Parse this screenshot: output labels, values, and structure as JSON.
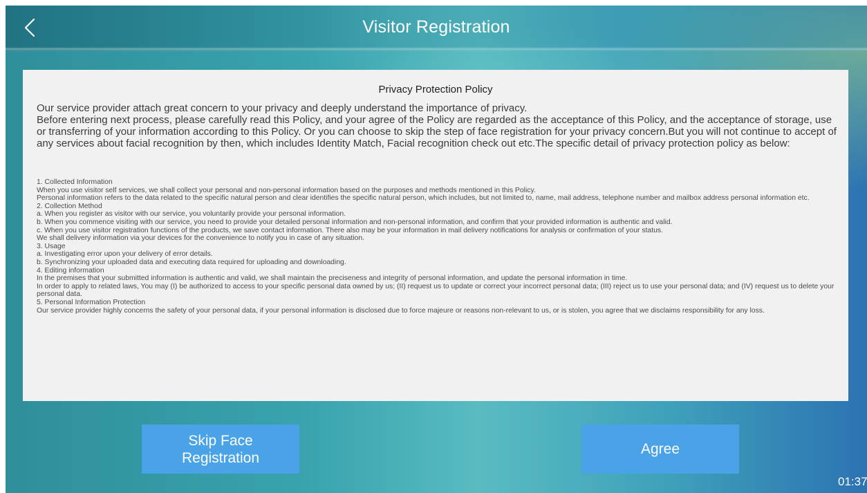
{
  "header": {
    "title": "Visitor Registration",
    "back_icon": "chevron-left-icon"
  },
  "policy": {
    "title": "Privacy Protection Policy",
    "intro": [
      "Our service provider attach great concern to your privacy and deeply understand the importance of privacy.",
      "Before entering next process, please carefully read this Policy, and your agree of the Policy are regarded as the acceptance of this Policy, and the acceptance of storage, use or transferring of your information according to this Policy. Or you can choose to skip the step of face registration for your privacy concern.But you will not continue to accept of any services about facial recognition by then, which includes Identity Match, Facial recognition check out etc.The specific detail of privacy protection policy as below:"
    ],
    "body": [
      "1. Collected Information",
      "When you use visitor self services, we shall collect your personal and non-personal information based on the purposes and methods mentioned in this Policy.",
      "Personal information refers to the data related to the specific natural person and clear identifies the specific natural person, which includes, but not limited to, name, mail address, telephone number and mailbox address personal information etc.",
      "2. Collection Method",
      "a. When you register as visitor with our service, you voluntarily provide your personal information.",
      "b. When you commence visiting with our service, you need to provide your detailed personal information and non-personal information, and confirm that your provided information is authentic and valid.",
      "c. When you use visitor registration functions of the products, we save contact information. There also may be your information in mail delivery notifications for analysis or confirmation of your status.",
      "We shall delivery information via your devices for the convenience to notify you in case of any situation.",
      "3. Usage",
      "a. Investigating error upon your delivery of error details.",
      "b. Synchronizing your uploaded data and executing data required for uploading and downloading.",
      "4. Editing information",
      "In the premises that your submitted information is authentic and valid, we shall maintain the preciseness and integrity of personal information, and update the personal information in time.",
      "In order to apply to related laws, You may (I) be authorized to access to your specific personal data owned by us; (II) request us to update or correct your incorrect personal data; (III) reject us to use your personal data; and (IV) request us to delete your personal data.",
      "5. Personal Information Protection",
      "Our service provider highly concerns the safety of your personal data, if your personal information is disclosed due to force majeure or reasons non-relevant to us, or is stolen, you agree that we disclaims responsibility for any loss."
    ]
  },
  "actions": {
    "skip_label": "Skip Face Registration",
    "agree_label": "Agree"
  },
  "status": {
    "clock": "01:37"
  },
  "colors": {
    "button": "#4aa3e6",
    "panel": "#f1f1f1"
  }
}
